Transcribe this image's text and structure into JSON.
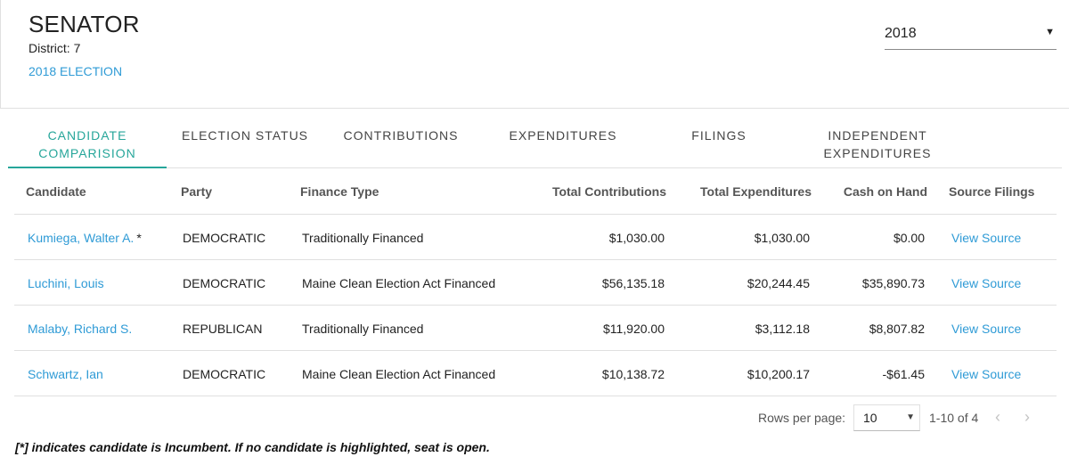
{
  "header": {
    "office": "SENATOR",
    "district_label": "District:",
    "district_number": "7",
    "election_link": "2018 ELECTION"
  },
  "year_select": {
    "value": "2018"
  },
  "tabs": [
    {
      "label_line1": "CANDIDATE",
      "label_line2": "COMPARISION",
      "active": true
    },
    {
      "label_line1": "ELECTION STATUS",
      "label_line2": ""
    },
    {
      "label_line1": "CONTRIBUTIONS",
      "label_line2": ""
    },
    {
      "label_line1": "EXPENDITURES",
      "label_line2": ""
    },
    {
      "label_line1": "FILINGS",
      "label_line2": ""
    },
    {
      "label_line1": "INDEPENDENT",
      "label_line2": "EXPENDITURES"
    }
  ],
  "table": {
    "columns": [
      "Candidate",
      "Party",
      "Finance Type",
      "Total Contributions",
      "Total Expenditures",
      "Cash on Hand",
      "Source Filings"
    ],
    "rows": [
      {
        "candidate": "Kumiega, Walter A.",
        "incumbent_mark": "*",
        "party": "DEMOCRATIC",
        "finance_type": "Traditionally Financed",
        "contributions": "$1,030.00",
        "expenditures": "$1,030.00",
        "cash": "$0.00",
        "source": "View Source"
      },
      {
        "candidate": "Luchini, Louis",
        "incumbent_mark": "",
        "party": "DEMOCRATIC",
        "finance_type": "Maine Clean Election Act Financed",
        "contributions": "$56,135.18",
        "expenditures": "$20,244.45",
        "cash": "$35,890.73",
        "source": "View Source"
      },
      {
        "candidate": "Malaby, Richard S.",
        "incumbent_mark": "",
        "party": "REPUBLICAN",
        "finance_type": "Traditionally Financed",
        "contributions": "$11,920.00",
        "expenditures": "$3,112.18",
        "cash": "$8,807.82",
        "source": "View Source"
      },
      {
        "candidate": "Schwartz, Ian",
        "incumbent_mark": "",
        "party": "DEMOCRATIC",
        "finance_type": "Maine Clean Election Act Financed",
        "contributions": "$10,138.72",
        "expenditures": "$10,200.17",
        "cash": "-$61.45",
        "source": "View Source"
      }
    ]
  },
  "pager": {
    "rows_per_page_label": "Rows per page:",
    "rows_per_page_value": "10",
    "range": "1-10 of 4"
  },
  "footnote": "[*] indicates candidate is Incumbent. If no candidate is highlighted, seat is open.",
  "colors": {
    "link": "#2f9bd6",
    "active_tab": "#26a69a"
  }
}
